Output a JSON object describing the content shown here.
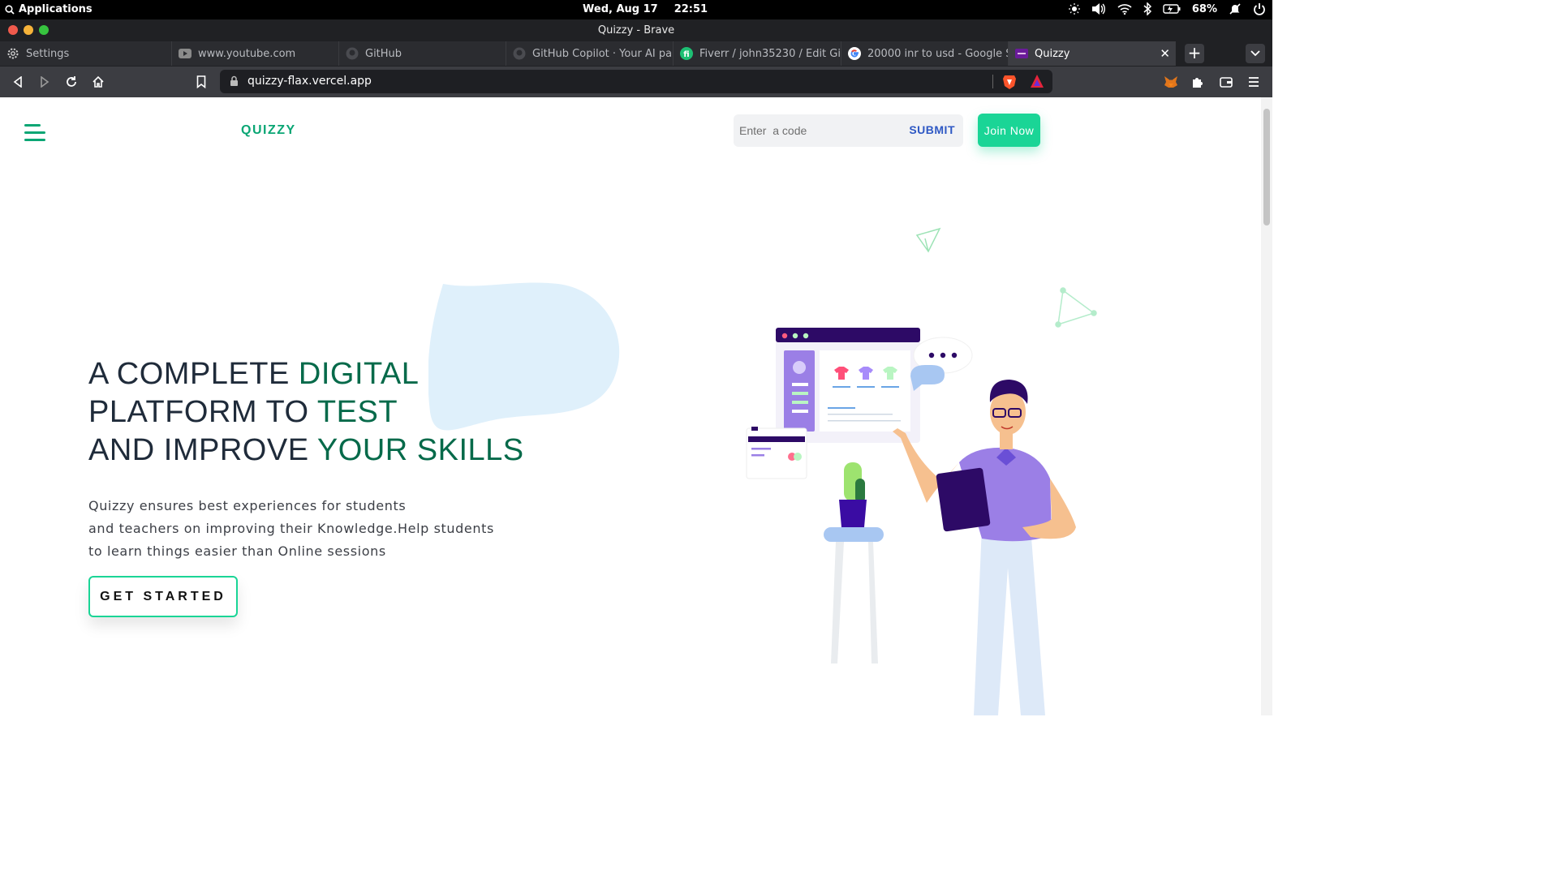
{
  "system_bar": {
    "applications": "Applications",
    "date": "Wed, Aug 17",
    "time": "22:51",
    "battery": "68%"
  },
  "window": {
    "title": "Quizzy - Brave"
  },
  "tabs": [
    {
      "label": "Settings",
      "icon": "gear-icon"
    },
    {
      "label": "www.youtube.com",
      "icon": "youtube-icon"
    },
    {
      "label": "GitHub",
      "icon": "github-icon"
    },
    {
      "label": "GitHub Copilot · Your AI pair p",
      "icon": "github-icon"
    },
    {
      "label": "Fiverr / john35230 / Edit Gig",
      "icon": "fiverr-icon"
    },
    {
      "label": "20000 inr to usd - Google Se",
      "icon": "google-icon"
    },
    {
      "label": "Quizzy",
      "icon": "quizzy-favicon",
      "active": true
    }
  ],
  "address_bar": {
    "url": "quizzy-flax.vercel.app"
  },
  "page": {
    "brand": "QUIZZY",
    "code_input": {
      "placeholder": "Enter  a code",
      "value": ""
    },
    "submit_label": "SUBMIT",
    "join_label": "Join Now",
    "hero": {
      "line1_a": "A COMPLETE ",
      "line1_b": "DIGITAL",
      "line2_a": "PLATFORM TO ",
      "line2_b": "TEST",
      "line3_a": "AND IMPROVE ",
      "line3_b": "YOUR SKILLS"
    },
    "description": [
      "Quizzy ensures best experiences for students",
      "and teachers on improving their Knowledge.Help students",
      "to learn things easier than Online sessions"
    ],
    "cta_label": "GET STARTED"
  },
  "colors": {
    "brand_green": "#0aa674",
    "accent_green": "#1ad596",
    "heading_dark": "#1f2b3a",
    "heading_highlight": "#066a4a",
    "submit_blue": "#2e58c4",
    "illustration_purple": "#9b7fe6"
  }
}
